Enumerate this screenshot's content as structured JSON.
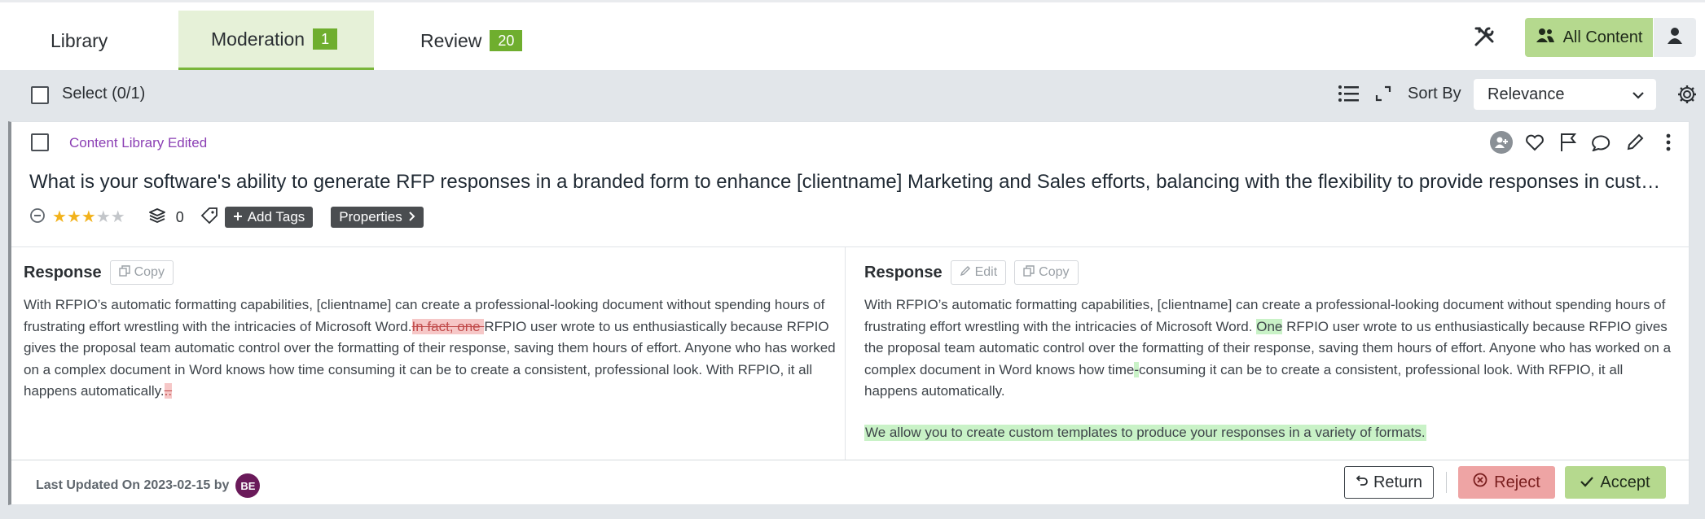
{
  "tabs": {
    "library": {
      "label": "Library"
    },
    "moderation": {
      "label": "Moderation",
      "count": "1"
    },
    "review": {
      "label": "Review",
      "count": "20"
    }
  },
  "header": {
    "all_content_label": "All Content"
  },
  "toolbar": {
    "select_label": "Select (0/1)",
    "sort_by_label": "Sort By",
    "sort_value": "Relevance"
  },
  "card": {
    "status": "Content Library Edited",
    "question": "What is your software's ability to generate RFP responses in a branded form to enhance [clientname] Marketing and Sales efforts, balancing with the flexibility to provide responses in customer-s...",
    "rating": 3,
    "rating_max": 5,
    "alternates_count": "0",
    "add_tags_label": "Add Tags",
    "properties_label": "Properties",
    "left": {
      "title": "Response",
      "copy_label": "Copy",
      "text_1": "With RFPIO’s automatic formatting capabilities, [clientname] can create a professional-looking document without spending hours of frustrating effort wrestling with the intricacies of Microsoft Word.",
      "deleted_1": "In fact, one ",
      "text_2": "RFPIO user wrote to us enthusiastically because RFPIO gives the proposal team automatic control over the formatting of their response, saving them hours of effort. Anyone who has worked on a complex document in Word knows how time consuming it can be to create a consistent, professional look. With RFPIO, it all happens automatically.",
      "deleted_2": ".."
    },
    "right": {
      "title": "Response",
      "edit_label": "Edit",
      "copy_label": "Copy",
      "text_1": "With RFPIO’s automatic formatting capabilities, [clientname] can create a professional-looking document without spending hours of frustrating effort wrestling with the intricacies of Microsoft Word. ",
      "inserted_1": "One",
      "text_2": " RFPIO user wrote to us enthusiastically because RFPIO gives the proposal team automatic control over the formatting of their response, saving them hours of effort. Anyone who has worked on a complex document in Word knows how time",
      "inserted_2": "-",
      "text_3": "consuming it can be to create a consistent, professional look. With RFPIO, it all happens automatically.",
      "inserted_paragraph": "We allow you to create custom templates to produce your responses in a variety of formats."
    },
    "footer": {
      "last_updated": "Last Updated On 2023-02-15 by",
      "avatar_initials": "BE",
      "return_label": "Return",
      "reject_label": "Reject",
      "accept_label": "Accept"
    }
  },
  "colors": {
    "accent_green": "#b5d98e",
    "badge_green": "#6fae2e",
    "reject_red": "#eea4a4",
    "status_purple": "#8b3fb4",
    "star_gold": "#f2b21b"
  },
  "icons": [
    "tools-icon",
    "user-group-icon",
    "user-icon",
    "list-icon",
    "expand-icon",
    "chevron-down-icon",
    "gear-icon",
    "assign-user-icon",
    "heart-icon",
    "flag-icon",
    "comment-icon",
    "pencil-icon",
    "more-vertical-icon",
    "minus-circle-icon",
    "star-icon",
    "layers-icon",
    "tag-icon",
    "plus-icon",
    "chevron-right-icon",
    "copy-icon",
    "undo-icon",
    "x-circle-icon",
    "check-icon"
  ]
}
